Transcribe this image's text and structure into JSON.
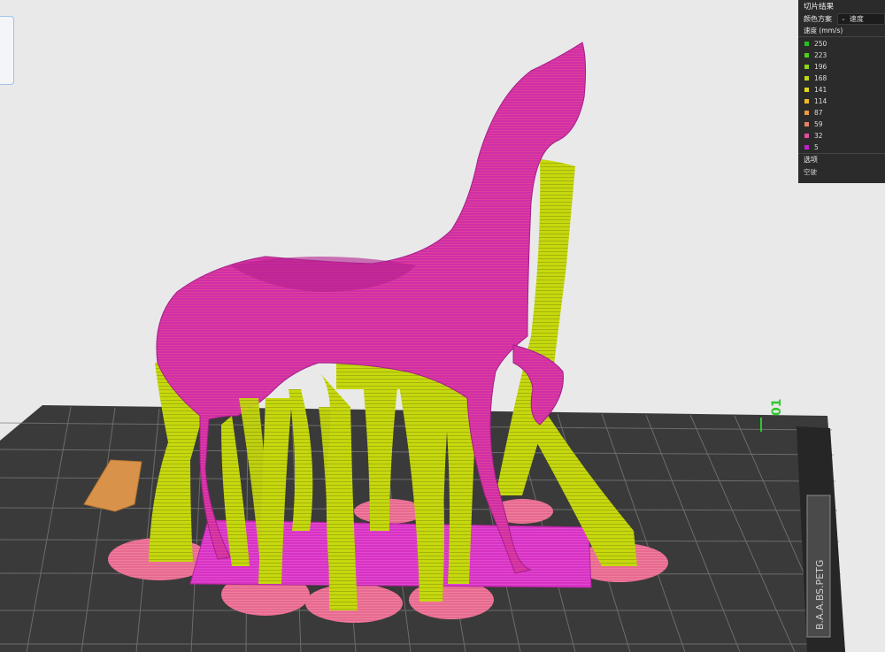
{
  "panel": {
    "title": "切片结果",
    "color_scheme_label": "颜色方案",
    "color_scheme_value": "速度",
    "speed_header": "速度 (mm/s)",
    "legend": [
      {
        "value": "250",
        "color": "#22c21f"
      },
      {
        "value": "223",
        "color": "#4fd11c"
      },
      {
        "value": "196",
        "color": "#8ed717"
      },
      {
        "value": "168",
        "color": "#c0d812"
      },
      {
        "value": "141",
        "color": "#e3d70f"
      },
      {
        "value": "114",
        "color": "#f0b92a"
      },
      {
        "value": "87",
        "color": "#ec9a45"
      },
      {
        "value": "59",
        "color": "#e8816a"
      },
      {
        "value": "32",
        "color": "#dd4f9e"
      },
      {
        "value": "5",
        "color": "#c21fcf"
      }
    ],
    "options_label": "选项",
    "options_item": "空驶"
  },
  "scene": {
    "plate_number": "01",
    "plate_label": "B.A.A.BS.PETG",
    "colors": {
      "plate": "#3a3a3a",
      "grid": "#7d7d7d",
      "support": "#c6d80e",
      "model": "#cf2fa6",
      "raft": "#d733c3",
      "brim": "#e76a90",
      "block": "#d9924a",
      "accent": "#2ec82e"
    }
  }
}
